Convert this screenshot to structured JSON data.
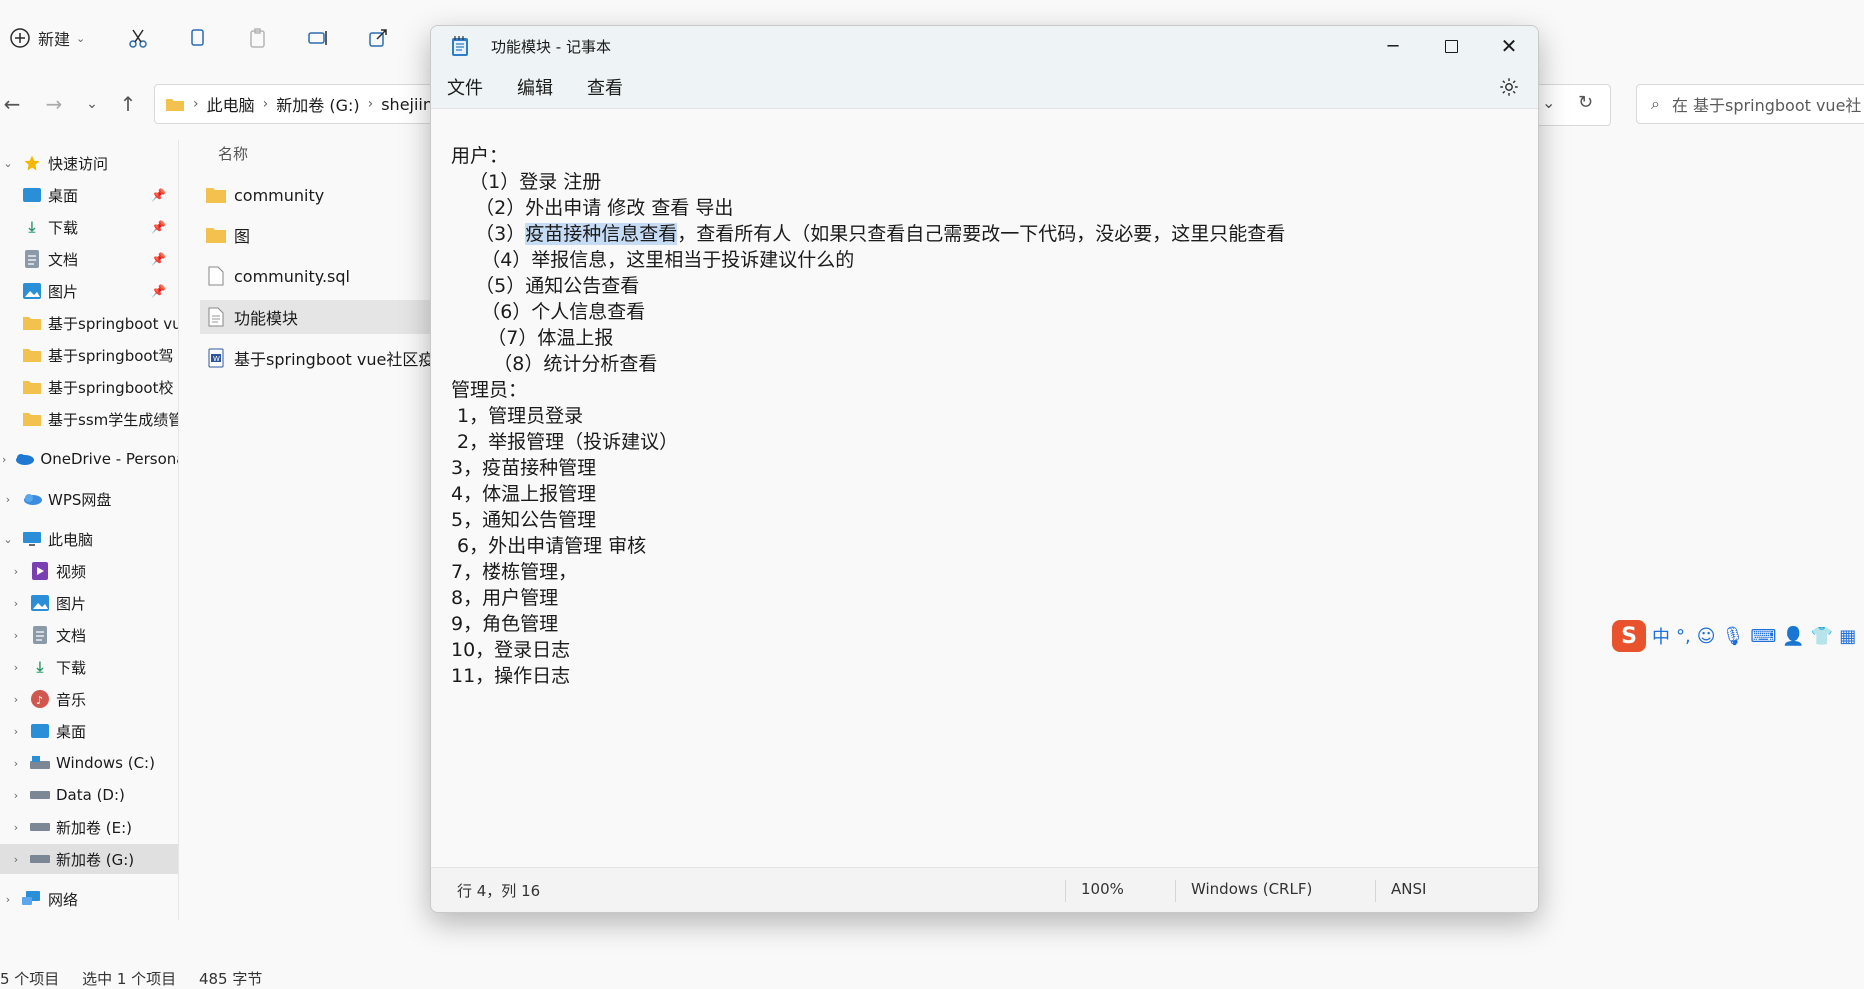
{
  "explorer": {
    "toolbar": {
      "new_label": "新建"
    },
    "address": {
      "crumbs": [
        "此电脑",
        "新加卷 (G:)",
        "shejiin"
      ]
    },
    "search": {
      "placeholder": "在 基于springboot vue社"
    },
    "sidebar": {
      "items": [
        {
          "label": "快速访问",
          "icon": "star-icon"
        },
        {
          "label": "桌面",
          "icon": "desktop-icon",
          "pinned": true
        },
        {
          "label": "下载",
          "icon": "download-icon",
          "pinned": true
        },
        {
          "label": "文档",
          "icon": "document-icon",
          "pinned": true
        },
        {
          "label": "图片",
          "icon": "picture-icon",
          "pinned": true
        },
        {
          "label": "基于springboot vu",
          "icon": "folder-icon"
        },
        {
          "label": "基于springboot驾",
          "icon": "folder-icon"
        },
        {
          "label": "基于springboot校",
          "icon": "folder-icon"
        },
        {
          "label": "基于ssm学生成绩管",
          "icon": "folder-icon"
        },
        {
          "label": "OneDrive - Persona",
          "icon": "cloud-icon"
        },
        {
          "label": "WPS网盘",
          "icon": "cloud-icon"
        },
        {
          "label": "此电脑",
          "icon": "computer-icon"
        },
        {
          "label": "视频",
          "icon": "video-icon"
        },
        {
          "label": "图片",
          "icon": "picture-icon"
        },
        {
          "label": "文档",
          "icon": "document-icon"
        },
        {
          "label": "下载",
          "icon": "download-icon"
        },
        {
          "label": "音乐",
          "icon": "music-icon"
        },
        {
          "label": "桌面",
          "icon": "desktop-icon"
        },
        {
          "label": "Windows (C:)",
          "icon": "drive-icon"
        },
        {
          "label": "Data (D:)",
          "icon": "drive-icon"
        },
        {
          "label": "新加卷 (E:)",
          "icon": "drive-icon"
        },
        {
          "label": "新加卷 (G:)",
          "icon": "drive-icon"
        },
        {
          "label": "网络",
          "icon": "network-icon"
        }
      ]
    },
    "file_list": {
      "column_name": "名称",
      "files": [
        {
          "name": "community",
          "icon": "folder-icon"
        },
        {
          "name": "图",
          "icon": "folder-icon"
        },
        {
          "name": "community.sql",
          "icon": "file-icon"
        },
        {
          "name": "功能模块",
          "icon": "text-file-icon"
        },
        {
          "name": "基于springboot vue社区疫情",
          "icon": "word-file-icon"
        }
      ]
    },
    "status": {
      "count": "5 个项目",
      "selected": "选中 1 个项目",
      "size": "485 字节"
    }
  },
  "ime": {
    "mode": "中",
    "punct": "°,"
  },
  "notepad": {
    "title": "功能模块 - 记事本",
    "menu": {
      "file": "文件",
      "edit": "编辑",
      "view": "查看"
    },
    "lines": {
      "l1": "用户：",
      "l2": "   （1）登录 注册",
      "l3": "    （2）外出申请 修改 查看 导出",
      "l4_prefix": "    （3）",
      "l4_selected": "疫苗接种信息查看",
      "l4_suffix": "，查看所有人（如果只查看自己需要改一下代码，没必要，这里只能查看",
      "l5": "     （4）举报信息，这里相当于投诉建议什么的",
      "l6": "    （5）通知公告查看",
      "l7": "     （6）个人信息查看",
      "l8": "      （7）体温上报",
      "l9": "       （8）统计分析查看",
      "l10": "管理员：",
      "l11": " 1，管理员登录",
      "l12": " 2，举报管理（投诉建议）",
      "l13": "3，疫苗接种管理",
      "l14": "4，体温上报管理",
      "l15": "5，通知公告管理",
      "l16": " 6，外出申请管理 审核",
      "l17": "7，楼栋管理，",
      "l18": "8，用户管理",
      "l19": "9，角色管理",
      "l20": "10，登录日志",
      "l21": "11，操作日志"
    },
    "status": {
      "position": "行 4，列 16",
      "zoom": "100%",
      "line_ending": "Windows (CRLF)",
      "encoding": "ANSI"
    }
  }
}
